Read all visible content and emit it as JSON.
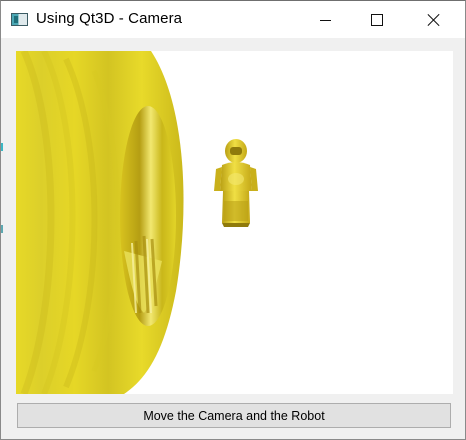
{
  "window": {
    "title": "Using Qt3D - Camera",
    "controls": {
      "minimize_icon": "minimize-icon",
      "maximize_icon": "maximize-icon",
      "close_icon": "close-icon"
    }
  },
  "scene": {
    "background_color": "#ffffff",
    "objects": [
      {
        "name": "torus",
        "color": "#e2d421"
      },
      {
        "name": "robot",
        "color": "#d9c21b"
      }
    ]
  },
  "actions": {
    "move_button_label": "Move the Camera and the Robot"
  }
}
